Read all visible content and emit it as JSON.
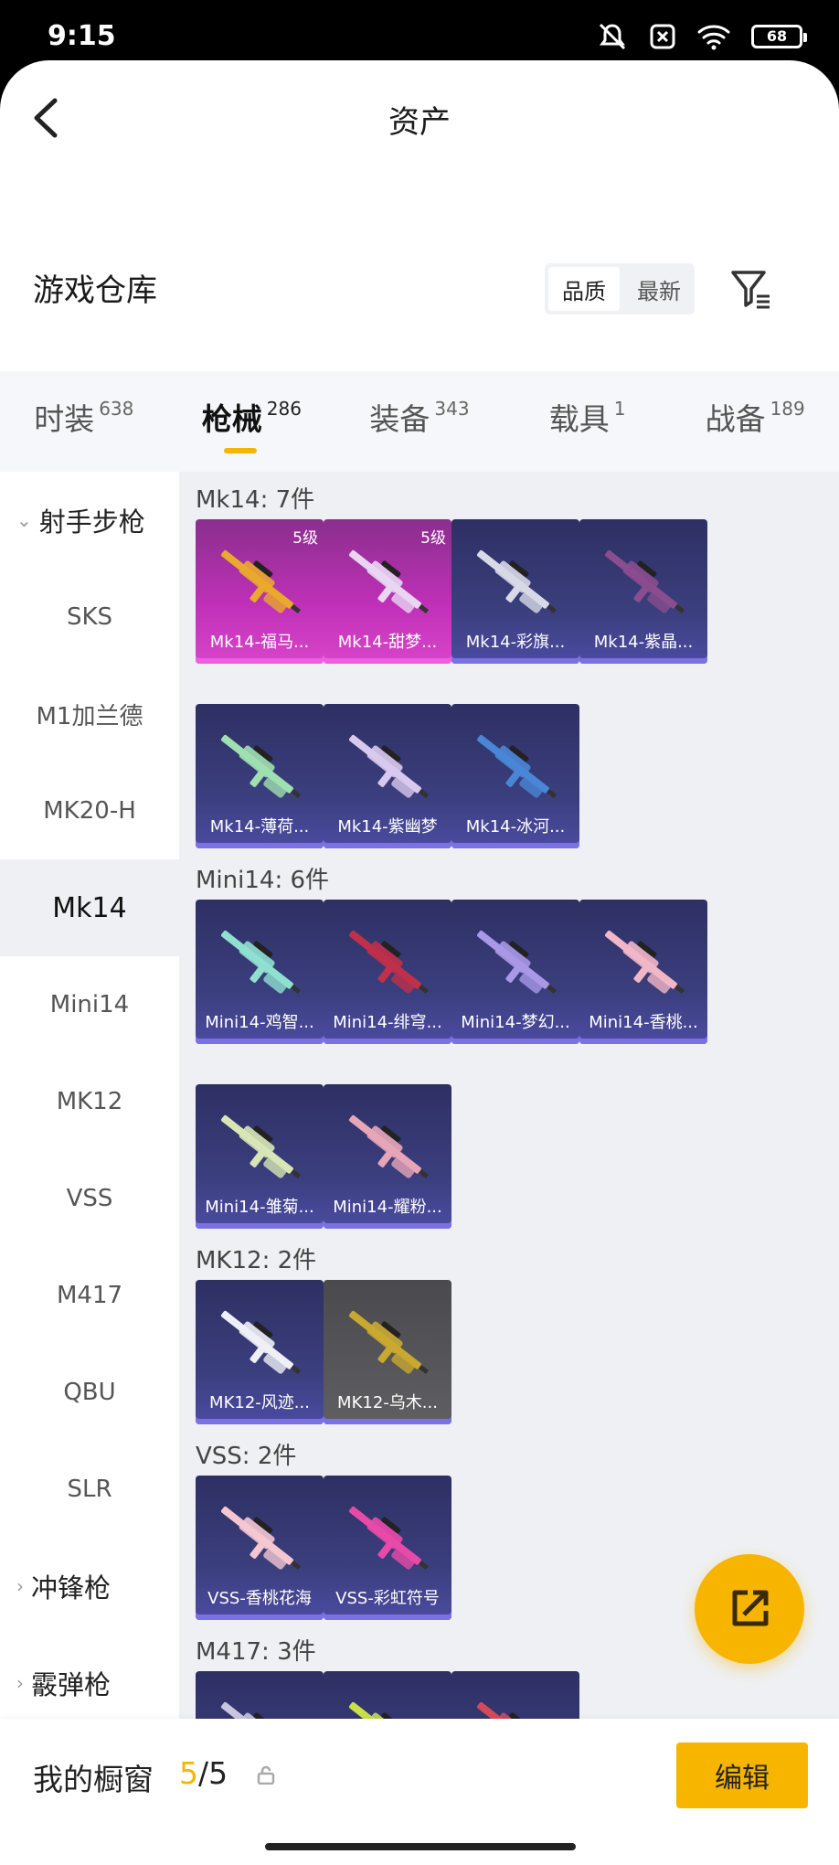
{
  "status_bar": {
    "time": "9:15",
    "battery": "68"
  },
  "nav": {
    "title": "资产"
  },
  "warehouse": {
    "title": "游戏仓库",
    "sort_options": [
      "品质",
      "最新"
    ],
    "active_sort": 0
  },
  "tabs": [
    {
      "label": "时装",
      "count": "638"
    },
    {
      "label": "枪械",
      "count": "286",
      "active": true
    },
    {
      "label": "装备",
      "count": "343"
    },
    {
      "label": "载具",
      "count": "1"
    },
    {
      "label": "战备",
      "count": "189"
    }
  ],
  "sidebar": {
    "group_label": "射手步枪",
    "items": [
      "SKS",
      "M1加兰德",
      "MK20-H",
      "Mk14",
      "Mini14",
      "MK12",
      "VSS",
      "M417",
      "QBU",
      "SLR"
    ],
    "active_item": "Mk14",
    "collapsed_groups": [
      "冲锋枪",
      "霰弹枪"
    ]
  },
  "sections": [
    {
      "title": "Mk14: 7件",
      "items": [
        {
          "name": "Mk14-福马...",
          "level": "5级",
          "rarity": "pink",
          "gun_color": "#e9a92c"
        },
        {
          "name": "Mk14-甜梦...",
          "level": "5级",
          "rarity": "pink",
          "gun_color": "#e9d6f2"
        },
        {
          "name": "Mk14-彩旗...",
          "rarity": "purple",
          "gun_color": "#d7d9e6"
        },
        {
          "name": "Mk14-紫晶...",
          "rarity": "purple",
          "gun_color": "#8a4d8f"
        },
        {
          "name": "Mk14-薄荷...",
          "rarity": "purple",
          "gun_color": "#9fe0b0"
        },
        {
          "name": "Mk14-紫幽梦",
          "rarity": "purple",
          "gun_color": "#d9c9ee"
        },
        {
          "name": "Mk14-冰河...",
          "rarity": "purple",
          "gun_color": "#4a86d6"
        }
      ]
    },
    {
      "title": "Mini14: 6件",
      "items": [
        {
          "name": "Mini14-鸡智...",
          "rarity": "purple",
          "gun_color": "#8fe0cf"
        },
        {
          "name": "Mini14-绯穹...",
          "rarity": "purple",
          "gun_color": "#c0304a"
        },
        {
          "name": "Mini14-梦幻...",
          "rarity": "purple",
          "gun_color": "#a898e6"
        },
        {
          "name": "Mini14-香桃...",
          "rarity": "purple",
          "gun_color": "#f2b7c6"
        },
        {
          "name": "Mini14-雏菊...",
          "rarity": "purple",
          "gun_color": "#d7e6b4"
        },
        {
          "name": "Mini14-耀粉...",
          "rarity": "purple",
          "gun_color": "#e6a6b8"
        }
      ]
    },
    {
      "title": "MK12: 2件",
      "items": [
        {
          "name": "MK12-风迹...",
          "rarity": "purple",
          "gun_color": "#eef0f6"
        },
        {
          "name": "MK12-乌木...",
          "rarity": "grey",
          "gun_color": "#c9a830"
        }
      ]
    },
    {
      "title": "VSS: 2件",
      "items": [
        {
          "name": "VSS-香桃花海",
          "rarity": "purple",
          "gun_color": "#f4c6d0"
        },
        {
          "name": "VSS-彩虹符号",
          "rarity": "purple",
          "gun_color": "#e84aa8"
        }
      ]
    },
    {
      "title": "M417: 3件",
      "items": [
        {
          "name": "",
          "rarity": "purple",
          "gun_color": "#c9c6e0"
        },
        {
          "name": "",
          "rarity": "purple",
          "gun_color": "#c8e04a"
        },
        {
          "name": "",
          "rarity": "purple",
          "gun_color": "#d24a5a"
        }
      ]
    }
  ],
  "bottom_bar": {
    "label": "我的橱窗",
    "current": "5",
    "total": "/5",
    "edit_label": "编辑"
  },
  "colors": {
    "accent": "#f7b500"
  }
}
